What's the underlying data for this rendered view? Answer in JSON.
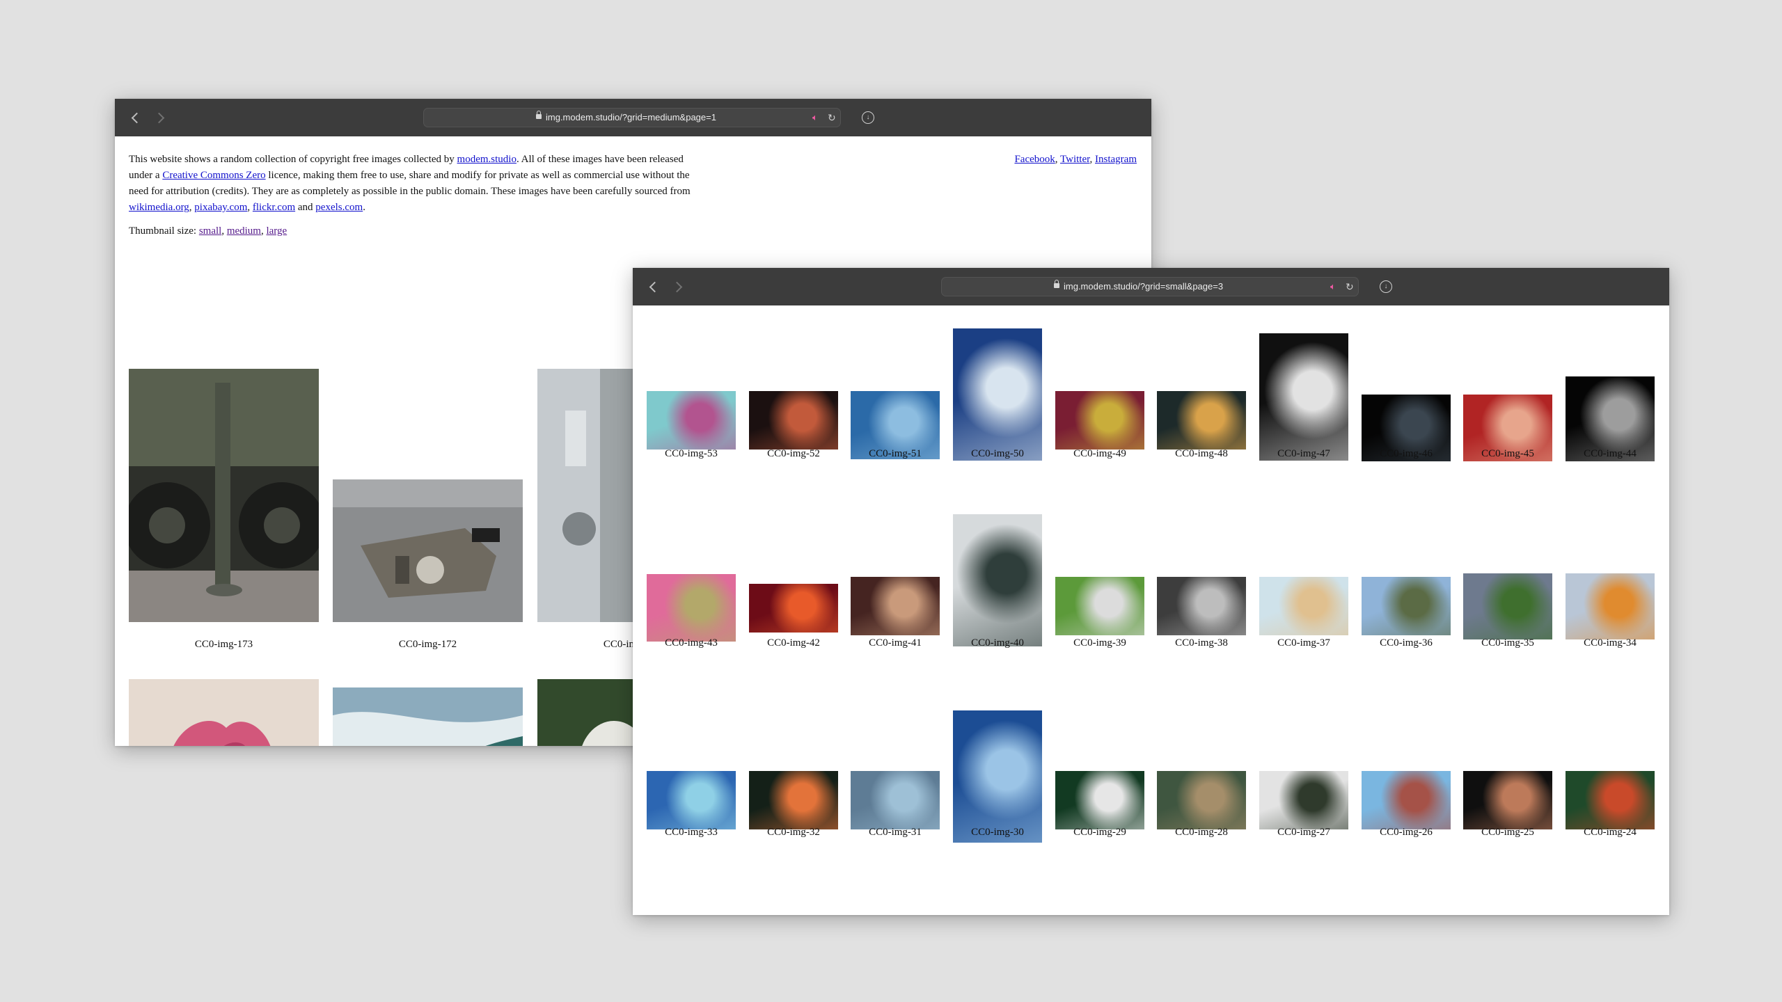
{
  "back_window": {
    "url": "img.modem.studio/?grid=medium&page=1",
    "intro": {
      "p1": "This website shows a random collection of copyright free images collected by ",
      "link_modem": "modem.studio",
      "p2": ". All of these images have been released under a ",
      "link_cc0": "Creative Commons Zero",
      "p3": " licence, making them free to use, share and modify for private as well as commercial use without the need for attribution (credits). They are as completely as possible in the public domain. These images have been carefully sourced from ",
      "link_wikimedia": "wikimedia.org",
      "sep1": ", ",
      "link_pixabay": "pixabay.com",
      "sep2": ", ",
      "link_flickr": "flickr.com",
      "and": " and ",
      "link_pexels": "pexels.com",
      "p4": "."
    },
    "social": {
      "facebook": "Facebook",
      "sep1": ", ",
      "twitter": "Twitter",
      "sep2": ", ",
      "instagram": "Instagram"
    },
    "thumbnail_size": {
      "label": "Thumbnail size: ",
      "small": "small",
      "sep1": ", ",
      "medium": "medium",
      "sep2": ", ",
      "large": "large"
    },
    "tiles": [
      {
        "caption": "CC0-img-173"
      },
      {
        "caption": "CC0-img-172"
      },
      {
        "caption": "CC0-img-171"
      }
    ]
  },
  "front_window": {
    "url": "img.modem.studio/?grid=small&page=3",
    "grid": [
      {
        "caption": "CC0-img-53",
        "colors": [
          "#7fc9cc",
          "#b2548f"
        ]
      },
      {
        "caption": "CC0-img-52",
        "colors": [
          "#1b1010",
          "#c25a3b"
        ]
      },
      {
        "caption": "CC0-img-51",
        "colors": [
          "#2b6aa8",
          "#8dbde0"
        ]
      },
      {
        "caption": "CC0-img-50",
        "colors": [
          "#1b3f84",
          "#d8e4ef"
        ]
      },
      {
        "caption": "CC0-img-49",
        "colors": [
          "#7a1e33",
          "#c9ad3b"
        ]
      },
      {
        "caption": "CC0-img-48",
        "colors": [
          "#1d2a2a",
          "#d9a24a"
        ]
      },
      {
        "caption": "CC0-img-47",
        "colors": [
          "#101010",
          "#e2e2e2"
        ]
      },
      {
        "caption": "CC0-img-46",
        "colors": [
          "#050505",
          "#3b4650"
        ]
      },
      {
        "caption": "CC0-img-45",
        "colors": [
          "#b12424",
          "#e7a58c"
        ]
      },
      {
        "caption": "CC0-img-44",
        "colors": [
          "#050505",
          "#9d9d9d"
        ]
      },
      {
        "caption": "CC0-img-43",
        "colors": [
          "#e06b9a",
          "#b3a86a"
        ]
      },
      {
        "caption": "CC0-img-42",
        "colors": [
          "#6d0c17",
          "#e85a2a"
        ]
      },
      {
        "caption": "CC0-img-41",
        "colors": [
          "#452421",
          "#c99a7b"
        ]
      },
      {
        "caption": "CC0-img-40",
        "colors": [
          "#d6dadc",
          "#2f3e3b"
        ]
      },
      {
        "caption": "CC0-img-39",
        "colors": [
          "#5c9a3a",
          "#dcdcdc"
        ]
      },
      {
        "caption": "CC0-img-38",
        "colors": [
          "#3d3d3d",
          "#bdbdbd"
        ]
      },
      {
        "caption": "CC0-img-37",
        "colors": [
          "#cfe2ea",
          "#e0c08f"
        ]
      },
      {
        "caption": "CC0-img-36",
        "colors": [
          "#8fb3d8",
          "#5b6b45"
        ]
      },
      {
        "caption": "CC0-img-35",
        "colors": [
          "#6e7a8e",
          "#3f6f2e"
        ]
      },
      {
        "caption": "CC0-img-34",
        "colors": [
          "#b9c6d6",
          "#e08b2f"
        ]
      },
      {
        "caption": "CC0-img-33",
        "colors": [
          "#2c66b2",
          "#8fd0e6"
        ]
      },
      {
        "caption": "CC0-img-32",
        "colors": [
          "#142018",
          "#e3733a"
        ]
      },
      {
        "caption": "CC0-img-31",
        "colors": [
          "#5e7c95",
          "#9ec0d6"
        ]
      },
      {
        "caption": "CC0-img-30",
        "colors": [
          "#1c4d94",
          "#9bc4e6"
        ]
      },
      {
        "caption": "CC0-img-29",
        "colors": [
          "#123a22",
          "#e6e6e6"
        ]
      },
      {
        "caption": "CC0-img-28",
        "colors": [
          "#3f5640",
          "#a58e6a"
        ]
      },
      {
        "caption": "CC0-img-27",
        "colors": [
          "#e3e3e3",
          "#2f3a2c"
        ]
      },
      {
        "caption": "CC0-img-26",
        "colors": [
          "#7ab6e0",
          "#a55248"
        ]
      },
      {
        "caption": "CC0-img-25",
        "colors": [
          "#0f0f0f",
          "#bd7a5a"
        ]
      },
      {
        "caption": "CC0-img-24",
        "colors": [
          "#1f4a2a",
          "#c94a2a"
        ]
      }
    ]
  }
}
